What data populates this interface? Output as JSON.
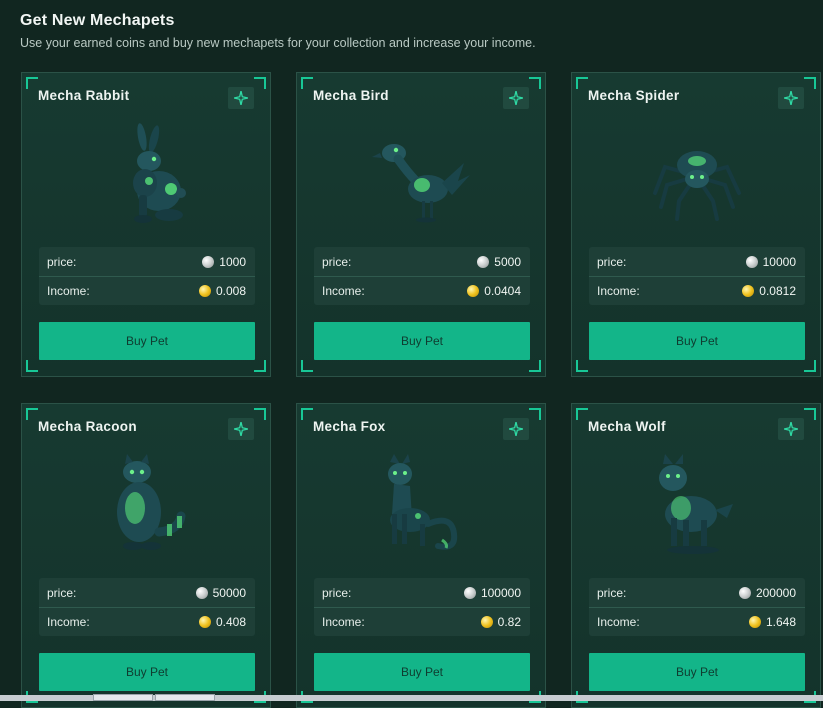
{
  "header": {
    "title": "Get New Mechapets",
    "subtitle": "Use your earned coins and buy new mechapets for your collection and increase your income."
  },
  "labels": {
    "price": "price:",
    "income": "Income:",
    "buy": "Buy Pet"
  },
  "colors": {
    "accent": "#13b589",
    "background": "#112620",
    "card": "#173a31",
    "pet_glow": "#57e07a",
    "pet_body": "#1e5257"
  },
  "pets": [
    {
      "name": "Mecha Rabbit",
      "price": "1000",
      "income": "0.008",
      "icon": "rabbit-icon"
    },
    {
      "name": "Mecha Bird",
      "price": "5000",
      "income": "0.0404",
      "icon": "bird-icon"
    },
    {
      "name": "Mecha Spider",
      "price": "10000",
      "income": "0.0812",
      "icon": "spider-icon"
    },
    {
      "name": "Mecha Racoon",
      "price": "50000",
      "income": "0.408",
      "icon": "racoon-icon"
    },
    {
      "name": "Mecha Fox",
      "price": "100000",
      "income": "0.82",
      "icon": "fox-icon"
    },
    {
      "name": "Mecha Wolf",
      "price": "200000",
      "income": "1.648",
      "icon": "wolf-icon"
    }
  ]
}
